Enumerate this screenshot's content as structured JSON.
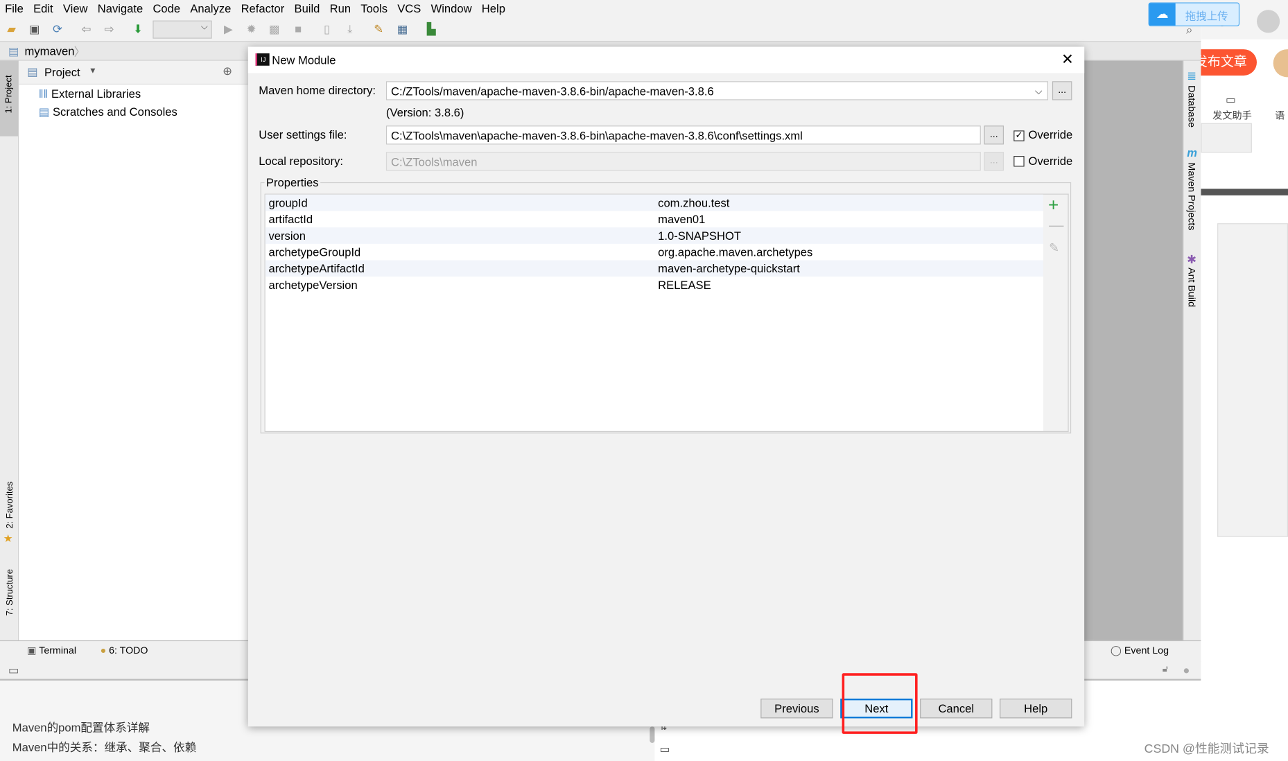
{
  "menu": [
    "File",
    "Edit",
    "View",
    "Navigate",
    "Code",
    "Analyze",
    "Refactor",
    "Build",
    "Run",
    "Tools",
    "VCS",
    "Window",
    "Help"
  ],
  "breadcrumb": "mymaven",
  "left_strip": {
    "project": "1: Project",
    "favorites": "2: Favorites",
    "structure": "7: Structure"
  },
  "project_panel": {
    "title": "Project",
    "items": [
      "External Libraries",
      "Scratches and Consoles"
    ]
  },
  "right_strip": {
    "database": "Database",
    "maven": "Maven Projects",
    "ant": "Ant Build"
  },
  "bottom_bar": {
    "terminal": "Terminal",
    "todo": "6: TODO",
    "event_log": "Event Log"
  },
  "dialog": {
    "title": "New Module",
    "maven_home_label": "Maven home directory:",
    "maven_home_value": "C:/ZTools/maven/apache-maven-3.8.6-bin/apache-maven-3.8.6",
    "version_text": "(Version: 3.8.6)",
    "user_settings_label": "User settings file:",
    "user_settings_value": "C:\\ZTools\\maven\\apache-maven-3.8.6-bin\\apache-maven-3.8.6\\conf\\settings.xml",
    "user_settings_override": {
      "label": "Override",
      "checked": true
    },
    "local_repo_label": "Local repository:",
    "local_repo_value": "C:\\ZTools\\maven",
    "local_repo_override": {
      "label": "Override",
      "checked": false
    },
    "browse_label": "...",
    "properties_title": "Properties",
    "properties": [
      {
        "key": "groupId",
        "value": "com.zhou.test"
      },
      {
        "key": "artifactId",
        "value": "maven01"
      },
      {
        "key": "version",
        "value": "1.0-SNAPSHOT"
      },
      {
        "key": "archetypeGroupId",
        "value": "org.apache.maven.archetypes"
      },
      {
        "key": "archetypeArtifactId",
        "value": "maven-archetype-quickstart"
      },
      {
        "key": "archetypeVersion",
        "value": "RELEASE"
      }
    ],
    "buttons": {
      "previous": "Previous",
      "next": "Next",
      "cancel": "Cancel",
      "help": "Help"
    }
  },
  "browser": {
    "upload": "拖拽上传",
    "publish": "发布文章",
    "assistant": "发文助手",
    "lang": "语"
  },
  "article_links": [
    "Maven的pom配置体系详解",
    "Maven中的关系：继承、聚合、依赖"
  ],
  "watermark": "CSDN @性能测试记录",
  "colors": {
    "highlight_box": "#ff2020",
    "focus": "#0078d7",
    "publish": "#fc5531"
  }
}
